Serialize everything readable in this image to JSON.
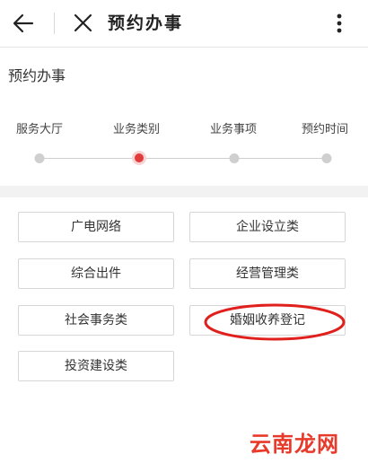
{
  "topbar": {
    "title": "预约办事",
    "icons": {
      "back": "arrow-left-icon",
      "close": "close-icon",
      "more": "more-vertical-icon"
    }
  },
  "page": {
    "title": "预约办事"
  },
  "steps": {
    "items": [
      {
        "label": "服务大厅",
        "active": false
      },
      {
        "label": "业务类别",
        "active": true
      },
      {
        "label": "业务事项",
        "active": false
      },
      {
        "label": "预约时间",
        "active": false
      }
    ]
  },
  "categories": [
    {
      "label": "广电网络"
    },
    {
      "label": "企业设立类"
    },
    {
      "label": "综合出件"
    },
    {
      "label": "经营管理类"
    },
    {
      "label": "社会事务类"
    },
    {
      "label": "婚姻收养登记"
    },
    {
      "label": "投资建设类"
    }
  ],
  "colors": {
    "accent": "#e23b3b",
    "annotation": "#e0201c",
    "watermark": "#e83a2a"
  },
  "watermark": "云南龙网"
}
